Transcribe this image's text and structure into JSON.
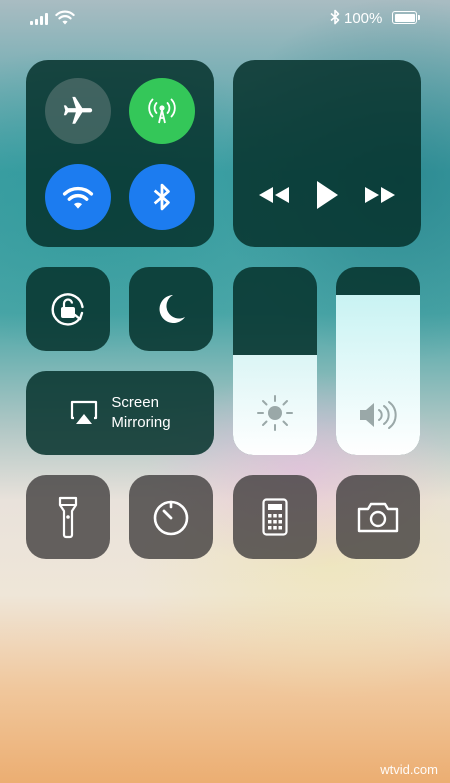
{
  "status_bar": {
    "battery_percent": "100%"
  },
  "connectivity": {
    "airplane_on": false,
    "cellular_on": true,
    "wifi_on": true,
    "bluetooth_on": true
  },
  "media": {
    "controls": [
      "rewind",
      "play",
      "fast-forward"
    ]
  },
  "controls": {
    "screen_mirroring": {
      "line1": "Screen",
      "line2": "Mirroring"
    }
  },
  "sliders": {
    "brightness_level": 0.53,
    "volume_level": 0.85
  },
  "colors": {
    "module_bg": "#06322c",
    "green": "#34c759",
    "blue": "#1c7cf0",
    "gray_tile": "#3c3a3a",
    "slider_fill": "#eefafa"
  },
  "icons": [
    "airplane-icon",
    "cellular-icon",
    "wifi-icon",
    "bluetooth-icon",
    "rotation-lock-icon",
    "moon-icon",
    "airplay-icon",
    "sun-icon",
    "speaker-icon",
    "flashlight-icon",
    "timer-icon",
    "calculator-icon",
    "camera-icon"
  ],
  "watermark": "wtvid.com"
}
